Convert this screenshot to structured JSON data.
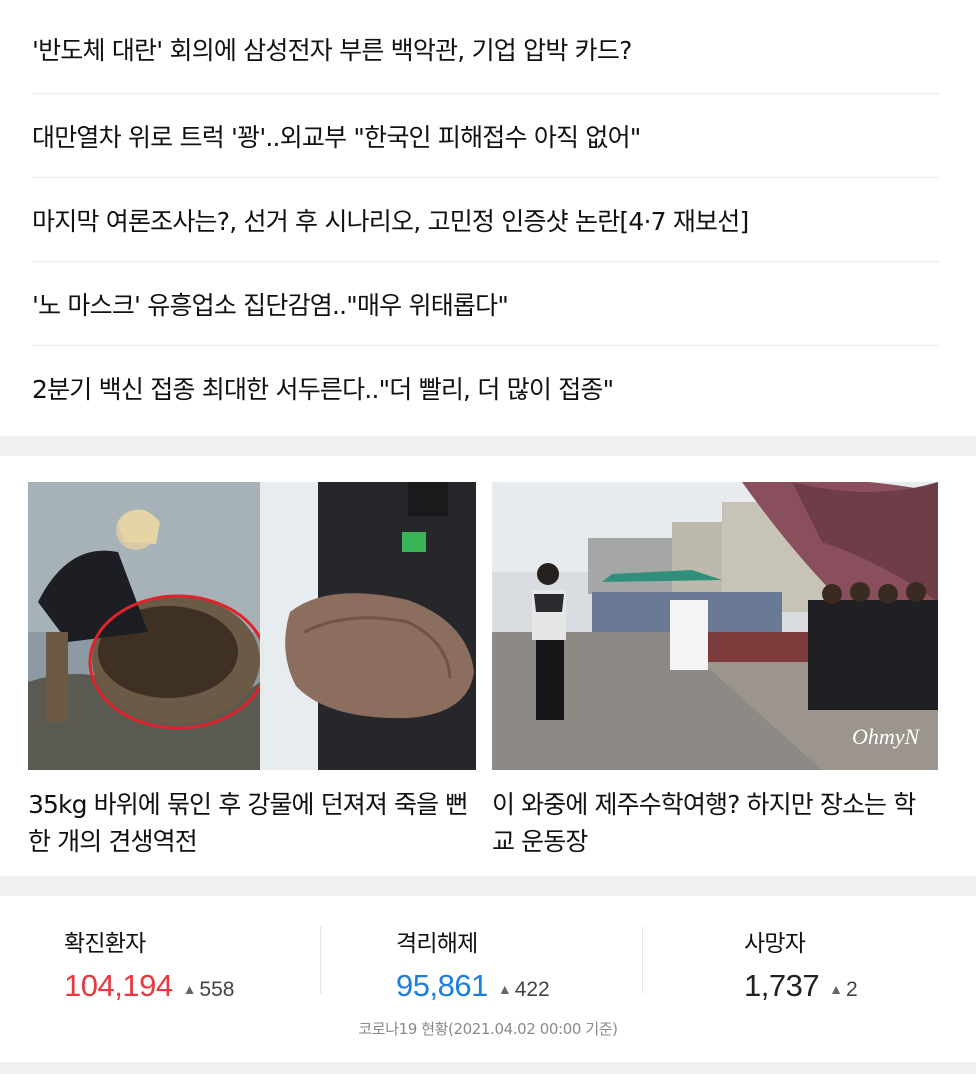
{
  "headlines": [
    "'반도체 대란' 회의에 삼성전자 부른 백악관, 기업 압박 카드?",
    "대만열차 위로 트럭 '꽝'..외교부 \"한국인 피해접수 아직 없어\"",
    "마지막 여론조사는?, 선거 후 시나리오, 고민정 인증샷 논란[4·7 재보선]",
    "'노 마스크' 유흥업소 집단감염..\"매우 위태롭다\"",
    "2분기 백신 접종 최대한 서두른다..\"더 빨리, 더 많이 접종\""
  ],
  "photo_news": [
    {
      "caption": "35kg 바위에 묶인 후 강물에 던져져 죽을 뻔한 개의 견생역전"
    },
    {
      "caption": "이 와중에 제주수학여행? 하지만 장소는 학교 운동장",
      "watermark": "OhmyN"
    }
  ],
  "covid": {
    "confirmed": {
      "label": "확진환자",
      "value": "104,194",
      "delta": "558",
      "color": "#e8383d"
    },
    "released": {
      "label": "격리해제",
      "value": "95,861",
      "delta": "422",
      "color": "#1a7fe0"
    },
    "deaths": {
      "label": "사망자",
      "value": "1,737",
      "delta": "2",
      "color": "#222222"
    },
    "delta_symbol": "▲",
    "footnote": "코로나19 현황(2021.04.02 00:00 기준)"
  }
}
